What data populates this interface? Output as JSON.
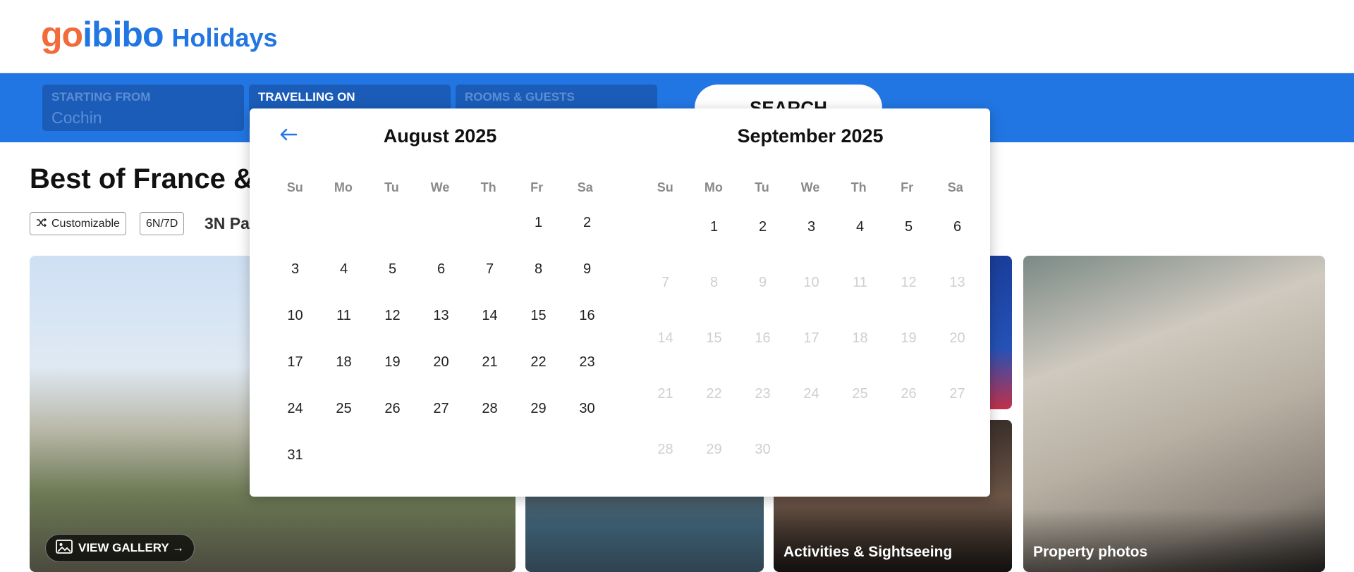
{
  "header": {
    "logo_go": "go",
    "logo_ibibo": "ibibo",
    "logo_suffix": "Holidays"
  },
  "search": {
    "starting_from": {
      "label": "STARTING FROM",
      "value": "Cochin"
    },
    "travelling_on": {
      "label": "TRAVELLING ON",
      "value": ""
    },
    "rooms_guests": {
      "label": "ROOMS & GUESTS",
      "value": ""
    },
    "button": "SEARCH"
  },
  "package": {
    "title": "Best of France &",
    "tags": [
      "Customizable",
      "6N/7D"
    ],
    "nights": "3N Pa"
  },
  "gallery": {
    "view_gallery": "VIEW GALLERY →",
    "captions": {
      "activities": "Activities & Sightseeing",
      "property": "Property photos"
    }
  },
  "calendar": {
    "weekdays": [
      "Su",
      "Mo",
      "Tu",
      "We",
      "Th",
      "Fr",
      "Sa"
    ],
    "months": [
      {
        "title": "August 2025",
        "weeks": [
          [
            "",
            "",
            "",
            "",
            "",
            "1",
            "2"
          ],
          [
            "3",
            "4",
            "5",
            "6",
            "7",
            "8",
            "9"
          ],
          [
            "10",
            "11",
            "12",
            "13",
            "14",
            "15",
            "16"
          ],
          [
            "17",
            "18",
            "19",
            "20",
            "21",
            "22",
            "23"
          ],
          [
            "24",
            "25",
            "26",
            "27",
            "28",
            "29",
            "30"
          ],
          [
            "31",
            "",
            "",
            "",
            "",
            "",
            ""
          ]
        ],
        "disabled_from": null
      },
      {
        "title": "September 2025",
        "weeks": [
          [
            "",
            "1",
            "2",
            "3",
            "4",
            "5",
            "6"
          ],
          [
            "7",
            "8",
            "9",
            "10",
            "11",
            "12",
            "13"
          ],
          [
            "14",
            "15",
            "16",
            "17",
            "18",
            "19",
            "20"
          ],
          [
            "21",
            "22",
            "23",
            "24",
            "25",
            "26",
            "27"
          ],
          [
            "28",
            "29",
            "30",
            "",
            "",
            "",
            ""
          ]
        ],
        "disabled_from": 7
      }
    ]
  },
  "colors": {
    "brand_blue": "#2276e3",
    "brand_orange": "#f26b3a",
    "disabled_day": "#cfcfcf"
  },
  "icons": {
    "back": "arrow-left-icon",
    "customizable": "shuffle-icon",
    "gallery": "image-icon"
  }
}
